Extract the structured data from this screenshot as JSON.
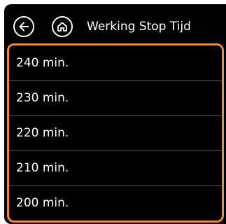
{
  "header": {
    "title": "Werking Stop Tijd",
    "back_icon": "arrow-left-icon",
    "home_icon": "home-icon"
  },
  "list": {
    "items": [
      {
        "label": "240 min."
      },
      {
        "label": "230 min."
      },
      {
        "label": "220 min."
      },
      {
        "label": "210 min."
      },
      {
        "label": "200 min."
      }
    ]
  },
  "colors": {
    "background": "#000000",
    "accent_border": "#f5892b",
    "text": "#ffffff",
    "divider": "#5a5a5a"
  }
}
